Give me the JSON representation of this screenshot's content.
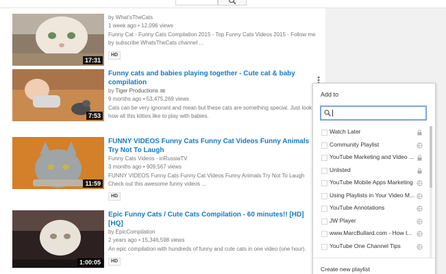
{
  "results": [
    {
      "title": "",
      "channel": "by What'sTheCats",
      "meta": "1 week ago • 12,096 views",
      "description": "Funny Cat - Funny Cats Compilation 2015 - Top Funny Cats Videos 2015 - Follow me by subscribe WhatsTheCats channel ...",
      "duration": "17:31",
      "badge": "HD"
    },
    {
      "title": "Funny cats and babies playing together - Cute cat & baby compilation",
      "channel_prefix": "by",
      "channel": "Tiger Productions",
      "meta": "9 months ago • 53,475,269 views",
      "description": "Cats can be very ignorant and mean but these cats are something special. Just look how all this kitties like to play with babies.",
      "duration": "7:53",
      "badge": "HD"
    },
    {
      "title": "FUNNY VIDEOS Funny Cats Funny Cat Videos Funny Animals Try Not To Laugh",
      "channel": "Funny Cats Videos - inRussiaTV",
      "meta": "3 months ago • 909,567 views",
      "description": "FUNNY VIDEOS Funny Cats Funny Cat Videos Funny Animals Try Not To Laugh Check out this awesome funny videos ...",
      "duration": "11:59",
      "badge": "HD"
    },
    {
      "title": "Epic Funny Cats / Cute Cats Compilation - 60 minutes!! [HD][HQ]",
      "channel": "by EpicCompilation",
      "meta": "2 years ago • 15,346,598 views",
      "description": "An epic compilation with hundreds of funny and cute cats in one video (one hour).",
      "duration": "1:00:05",
      "badge": "HD"
    }
  ],
  "add_to": {
    "heading": "Add to",
    "search_placeholder": "",
    "playlists": [
      {
        "label": "Watch Later",
        "icon": "lock-icon"
      },
      {
        "label": "Community Playlist",
        "icon": "globe-icon"
      },
      {
        "label": "YouTube Marketing and Video ...",
        "icon": "lock-icon"
      },
      {
        "label": "Unlisted",
        "icon": "lock-icon"
      },
      {
        "label": "YouTube Mobile Apps Marketing",
        "icon": "globe-icon"
      },
      {
        "label": "Using Playlists in Your Video M...",
        "icon": "globe-icon"
      },
      {
        "label": "YouTube Annotations",
        "icon": "globe-icon"
      },
      {
        "label": "JW Player",
        "icon": "globe-icon"
      },
      {
        "label": "www.MarcBullard.com - How t...",
        "icon": "globe-icon"
      },
      {
        "label": "YouTube One Channel Tips",
        "icon": "globe-icon"
      }
    ],
    "create_new": "Create new playlist"
  }
}
